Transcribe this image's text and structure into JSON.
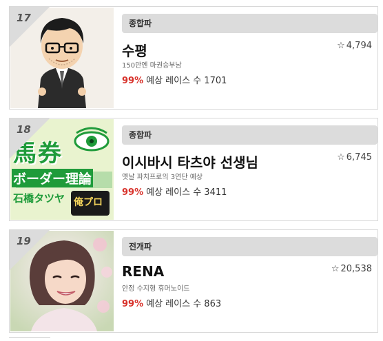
{
  "cards": [
    {
      "rank": "17",
      "tag": "종합파",
      "name": "수평",
      "rating": "4,794",
      "desc": "150만엔 마권승부남",
      "pct": "99%",
      "stat_label": "예상 레이스 수",
      "stat_value": "1701",
      "avatar_bg": "#f3efe9"
    },
    {
      "rank": "18",
      "tag": "종합파",
      "name": "이시바시 타츠야 선생님",
      "rating": "6,745",
      "desc": "옛날 파치프로의 3연단 예상",
      "pct": "99%",
      "stat_label": "예상 레이스 수",
      "stat_value": "3411",
      "logo_text": {
        "line1": "馬券",
        "line2": "ボーダー理論",
        "line3": "石橋タツヤ",
        "badge": "俺プロ"
      }
    },
    {
      "rank": "19",
      "tag": "전개파",
      "name": "RENA",
      "rating": "20,538",
      "desc": "안정 수지형 휴머노이드",
      "pct": "99%",
      "stat_label": "예상 레이스 수",
      "stat_value": "863"
    }
  ],
  "colors": {
    "accent_red": "#d8322b",
    "tag_bg": "#dcdcdc",
    "logo_green": "#1f9b3a"
  },
  "icons": {
    "rating": "star-outline-icon"
  }
}
